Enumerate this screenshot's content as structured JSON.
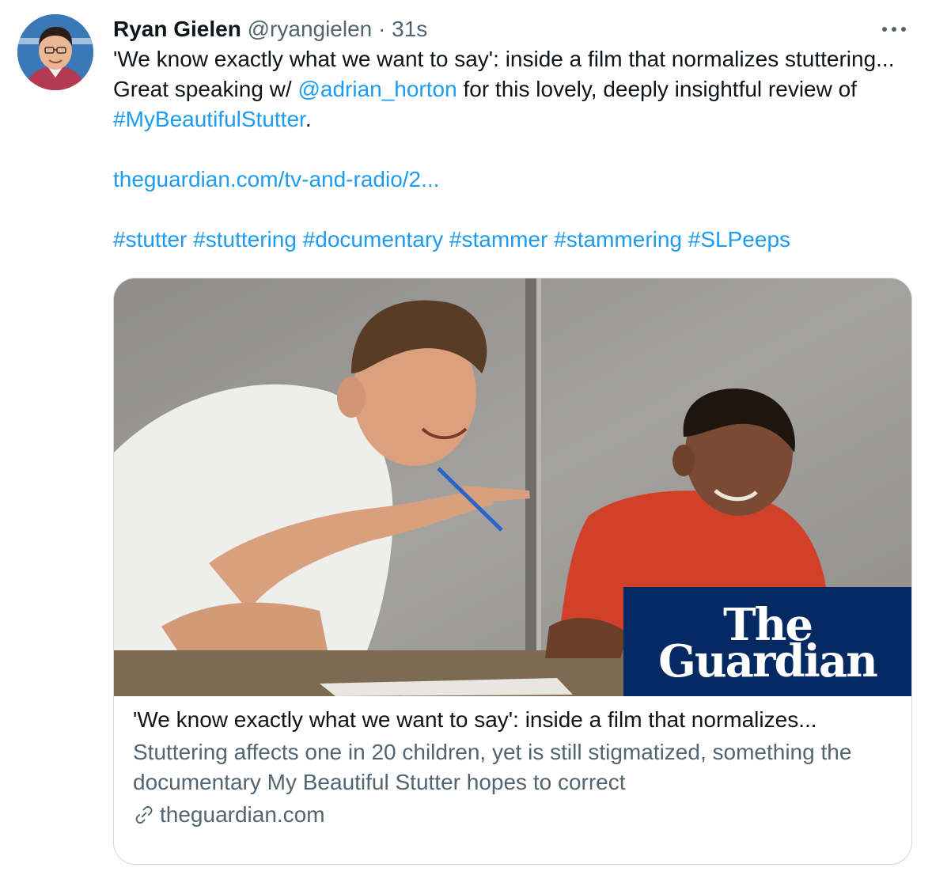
{
  "tweet": {
    "author_name": "Ryan Gielen",
    "author_handle": "@ryangielen",
    "separator": "·",
    "timestamp": "31s",
    "text_part1": "'We know exactly what we want to say': inside a film that normalizes stuttering... Great speaking w/ ",
    "mention": "@adrian_horton",
    "text_part2": " for this lovely, deeply insightful review of ",
    "hashtag_main": "#MyBeautifulStutter",
    "text_part3": ".",
    "url_text": "theguardian.com/tv-and-radio/2...",
    "hashtags": [
      "#stutter",
      "#stuttering",
      "#documentary",
      "#stammer",
      "#stammering",
      "#SLPeeps"
    ]
  },
  "card": {
    "logo_line1": "The",
    "logo_line2": "Guardian",
    "title": "'We know exactly what we want to say': inside a film that normalizes...",
    "description": "Stuttering affects one in 20 children, yet is still stigmatized, something the documentary My Beautiful Stutter hopes to correct",
    "domain": "theguardian.com"
  },
  "icons": {
    "more": "more-horizontal-icon",
    "link": "link-icon"
  },
  "colors": {
    "link": "#1d9bf0",
    "secondary_text": "#536471",
    "guardian_blue": "#052962"
  }
}
